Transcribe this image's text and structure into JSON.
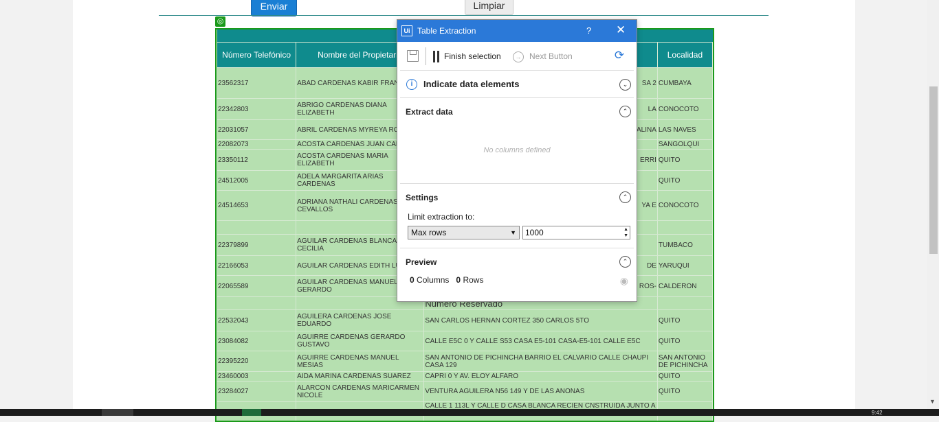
{
  "buttons": {
    "send": "Enviar",
    "clear": "Limpiar"
  },
  "table": {
    "headers": [
      "Número Telefónico",
      "Nombre del Propietario",
      "",
      "Localidad"
    ],
    "rows": [
      {
        "phone": "23562317",
        "name": "ABAD CARDENAS KABIR FRANCO",
        "address": "SA 2",
        "city": "CUMBAYA"
      },
      {
        "phone": "22342803",
        "name": "ABRIGO CARDENAS DIANA ELIZABETH",
        "address": "LA",
        "city": "CONOCOTO"
      },
      {
        "phone": "22031057",
        "name": "ABRIL CARDENAS MYREYA ROCIO",
        "address": "ALINA",
        "city": "LAS NAVES"
      },
      {
        "phone": "22082073",
        "name": "ACOSTA CARDENAS JUAN CARLOS",
        "address": "",
        "city": "SANGOLQUI"
      },
      {
        "phone": "23350112",
        "name": "ACOSTA CARDENAS MARIA ELIZABETH",
        "address": "ERRI",
        "city": "QUITO"
      },
      {
        "phone": "24512005",
        "name": "ADELA MARGARITA ARIAS CARDENAS",
        "address": "",
        "city": "QUITO"
      },
      {
        "phone": "24514653",
        "name": "ADRIANA NATHALI CARDENAS CEVALLOS",
        "address": "YA E",
        "city": "CONOCOTO"
      },
      {
        "phone": "",
        "name": "",
        "address": "",
        "city": ""
      },
      {
        "phone": "22379899",
        "name": "AGUILAR CARDENAS BLANCA CECILIA",
        "address": "",
        "city": "TUMBACO"
      },
      {
        "phone": "22166053",
        "name": "AGUILAR CARDENAS EDITH LUCIA",
        "address": "DE",
        "city": "YARUQUI"
      },
      {
        "phone": "22065589",
        "name": "AGUILAR CARDENAS MANUEL GERARDO",
        "address": "ROS-",
        "city": "CALDERON"
      },
      {
        "phone": "",
        "name": "",
        "address": "Numero Reservado",
        "city": ""
      },
      {
        "phone": "22532043",
        "name": "AGUILERA CARDENAS JOSE EDUARDO",
        "address": "SAN CARLOS HERNAN CORTEZ 350 CARLOS 5TO",
        "city": "QUITO"
      },
      {
        "phone": "23084082",
        "name": "AGUIRRE CARDENAS GERARDO GUSTAVO",
        "address": "CALLE E5C 0 Y CALLE S53 CASA E5-101 CASA-E5-101 CALLE E5C",
        "city": "QUITO"
      },
      {
        "phone": "22395220",
        "name": "AGUIRRE CARDENAS MANUEL MESIAS",
        "address": "SAN ANTONIO DE PICHINCHA BARRIO EL CALVARIO CALLE CHAUPI CASA 129",
        "city": "SAN ANTONIO DE PICHINCHA"
      },
      {
        "phone": "23460003",
        "name": "AIDA MARINA CARDENAS SUAREZ",
        "address": "CAPRI 0 Y AV. ELOY ALFARO",
        "city": "QUITO"
      },
      {
        "phone": "23284027",
        "name": "ALARCON CARDENAS MARICARMEN NICOLE",
        "address": "VENTURA AGUILERA N56 149 Y DE LAS ANONAS",
        "city": "QUITO"
      },
      {
        "phone": "",
        "name": "",
        "address": "CALLE 1 113L Y CALLE D CASA BLANCA RECIEN CNSTRUIDA JUNTO A",
        "city": ""
      }
    ]
  },
  "dialog": {
    "title": "Table Extraction",
    "logo": "Ui",
    "help": "?",
    "close": "✕",
    "toolbar": {
      "finish": "Finish selection",
      "next": "Next Button"
    },
    "indicate": "Indicate data elements",
    "extract": {
      "title": "Extract data",
      "empty": "No columns defined"
    },
    "settings": {
      "title": "Settings",
      "limit_label": "Limit extraction to:",
      "mode": "Max rows",
      "value": "1000"
    },
    "preview": {
      "title": "Preview",
      "columns": "0",
      "columns_label": "Columns",
      "rows": "0",
      "rows_label": "Rows"
    }
  },
  "taskbar": {
    "clock": "9:42"
  }
}
